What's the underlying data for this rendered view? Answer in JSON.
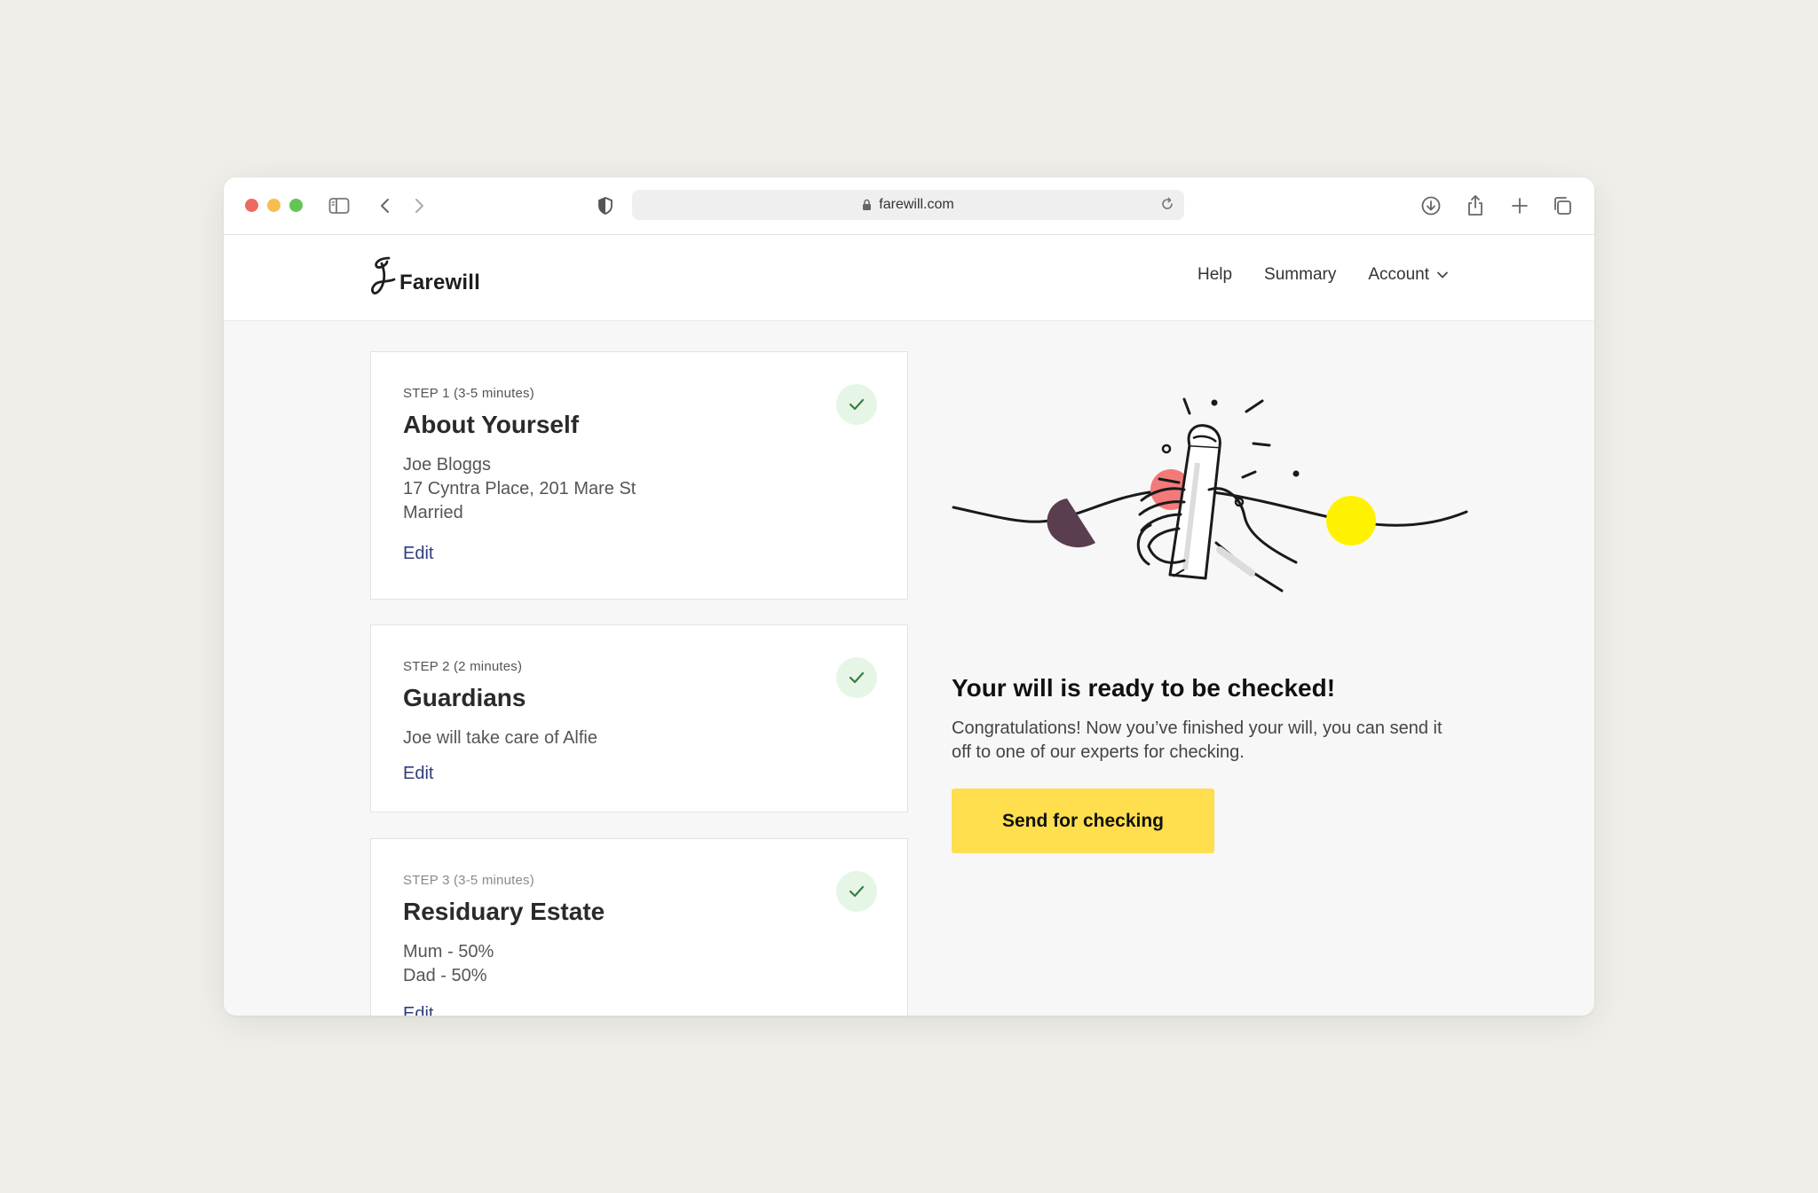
{
  "browser": {
    "url": "farewill.com"
  },
  "header": {
    "logo_text": "Farewill",
    "nav": {
      "help": "Help",
      "summary": "Summary",
      "account": "Account"
    }
  },
  "steps": [
    {
      "step_label": "STEP 1  (3-5 minutes)",
      "title": "About Yourself",
      "details": [
        "Joe Bloggs",
        "17 Cyntra Place, 201 Mare St",
        "Married"
      ],
      "edit_label": "Edit"
    },
    {
      "step_label": "STEP 2  (2 minutes)",
      "title": "Guardians",
      "details": [
        "Joe will take care of Alfie"
      ],
      "edit_label": "Edit"
    },
    {
      "step_label": "STEP 3  (3-5 minutes)",
      "title": "Residuary Estate",
      "details": [
        "Mum - 50%",
        "Dad - 50%"
      ],
      "edit_label": "Edit"
    }
  ],
  "completion": {
    "headline": "Your will is ready to be checked!",
    "body": "Congratulations! Now you’ve finished your will, you can send it off to one of our experts for checking.",
    "button_label": "Send for checking"
  },
  "colors": {
    "accent_yellow": "#ffdf4d",
    "link_blue": "#2f3c7e",
    "check_green": "#3a7d44",
    "check_bg": "#e6f6e6",
    "illus_pink": "#f47a7a",
    "illus_plum": "#5a3d4e",
    "illus_yellow": "#fff200"
  }
}
